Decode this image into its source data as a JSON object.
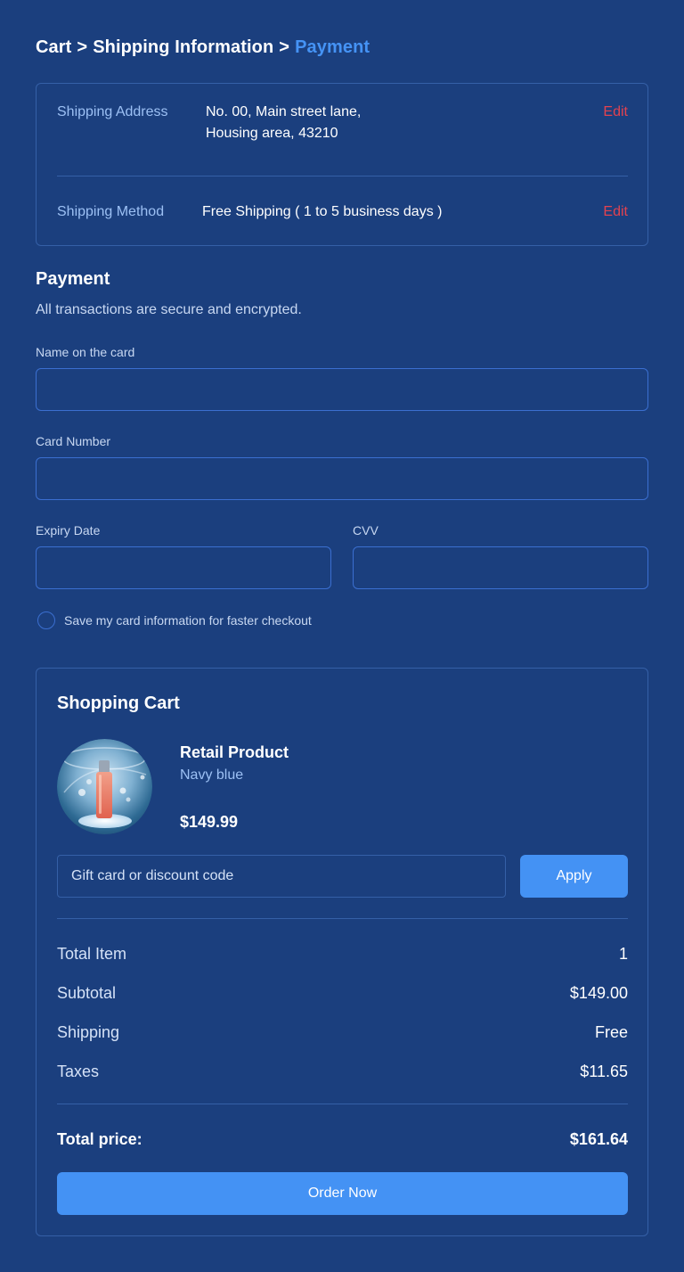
{
  "breadcrumb": {
    "items": [
      "Cart",
      "Shipping Information",
      "Payment"
    ],
    "separator": ">",
    "active_color": "#4593f5"
  },
  "shipping": {
    "address_label": "Shipping Address",
    "address_line1": "No. 00, Main street lane,",
    "address_line2": "Housing area, 43210",
    "method_label": "Shipping Method",
    "method_value": "Free Shipping ( 1 to 5 business days )",
    "edit_label": "Edit",
    "edit_color": "#e2424f"
  },
  "payment": {
    "title": "Payment",
    "subtitle": "All transactions are secure and encrypted.",
    "name_label": "Name on the card",
    "name_value": "",
    "card_number_label": "Card Number",
    "card_number_value": "",
    "expiry_label": "Expiry Date",
    "expiry_value": "",
    "cvv_label": "CVV",
    "cvv_value": "",
    "save_card_label": "Save my card information for faster checkout"
  },
  "cart": {
    "title": "Shopping Cart",
    "product": {
      "name": "Retail Product",
      "variant": "Navy blue",
      "price": "$149.99",
      "image_icon": "perfume-bottle-image"
    },
    "discount_placeholder": "Gift card or discount code",
    "apply_label": "Apply",
    "summary": {
      "total_item_label": "Total Item",
      "total_item_value": "1",
      "subtotal_label": "Subtotal",
      "subtotal_value": "$149.00",
      "shipping_label": "Shipping",
      "shipping_value": "Free",
      "taxes_label": "Taxes",
      "taxes_value": "$11.65",
      "total_label": "Total price:",
      "total_value": "$161.64"
    },
    "order_label": "Order Now"
  },
  "colors": {
    "background": "#1b3f7e",
    "accent": "#4492f4",
    "border": "#3560a7"
  }
}
